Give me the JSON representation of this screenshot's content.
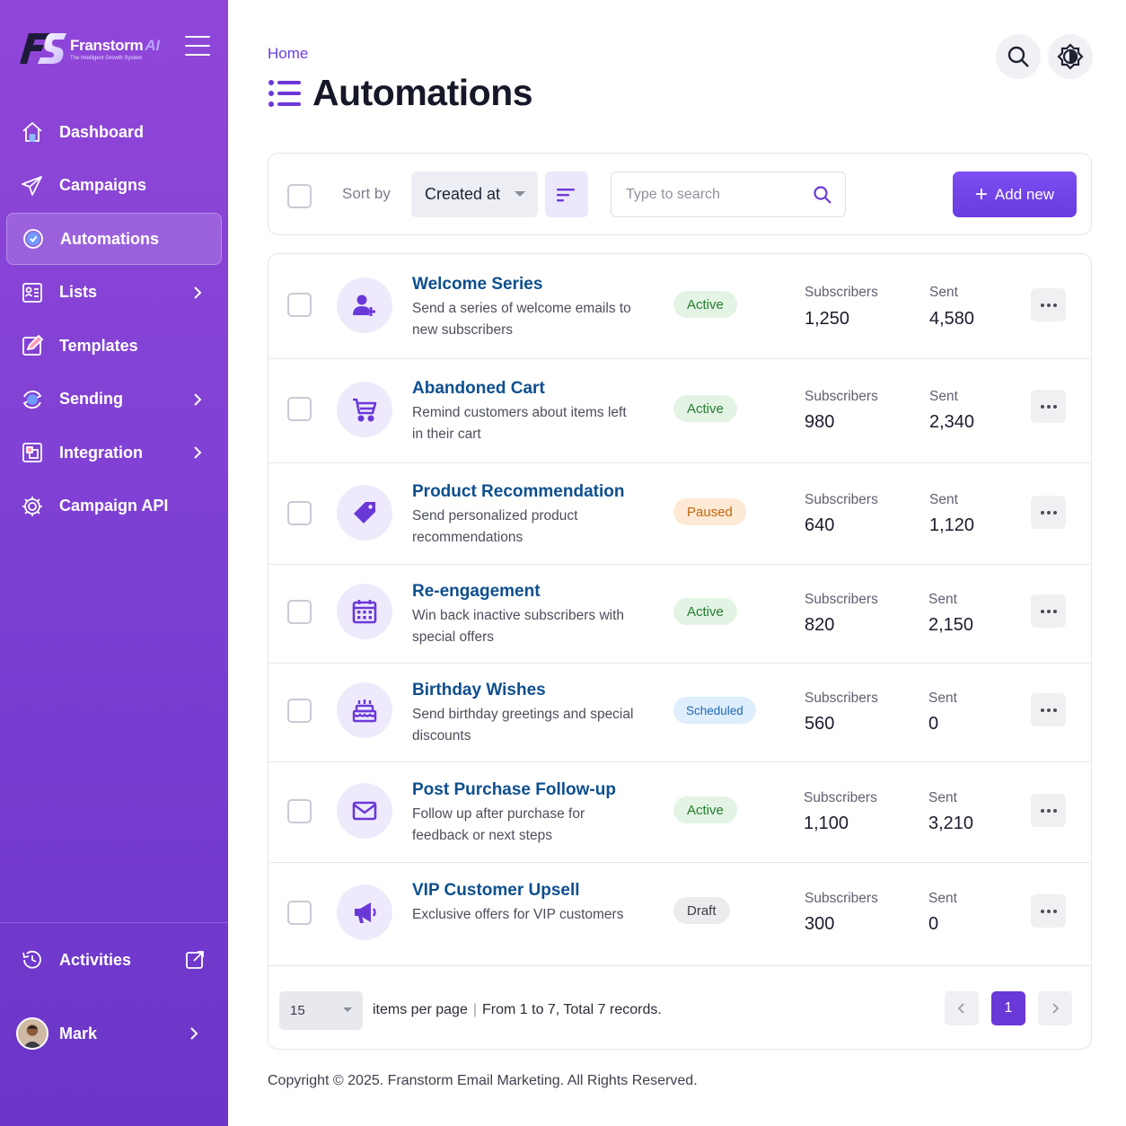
{
  "brand": {
    "name": "Franstorm",
    "suffix": "AI",
    "tagline": "The Intelligent Growth System"
  },
  "sidebar": {
    "items": [
      {
        "label": "Dashboard",
        "icon": "home-icon",
        "has_children": false
      },
      {
        "label": "Campaigns",
        "icon": "paper-plane-icon",
        "has_children": false
      },
      {
        "label": "Automations",
        "icon": "automation-cycle-icon",
        "has_children": false,
        "active": true
      },
      {
        "label": "Lists",
        "icon": "contact-list-icon",
        "has_children": true
      },
      {
        "label": "Templates",
        "icon": "template-edit-icon",
        "has_children": false
      },
      {
        "label": "Sending",
        "icon": "sending-cycle-icon",
        "has_children": true
      },
      {
        "label": "Integration",
        "icon": "integration-icon",
        "has_children": true
      },
      {
        "label": "Campaign API",
        "icon": "api-gear-icon",
        "has_children": false
      }
    ],
    "activities_label": "Activities",
    "user_name": "Mark"
  },
  "header": {
    "breadcrumb": "Home",
    "title": "Automations"
  },
  "toolbar": {
    "sort_label": "Sort by",
    "sort_value": "Created at",
    "search_placeholder": "Type to search",
    "add_label": "Add new"
  },
  "stat_labels": {
    "subscribers": "Subscribers",
    "sent": "Sent"
  },
  "automations": [
    {
      "title": "Welcome Series",
      "desc": "Send a series of welcome emails to new subscribers",
      "status": "Active",
      "status_kind": "active",
      "subscribers": "1,250",
      "sent": "4,580",
      "icon": "user-plus-icon"
    },
    {
      "title": "Abandoned Cart",
      "desc": "Remind customers about items left in their cart",
      "status": "Active",
      "status_kind": "active",
      "subscribers": "980",
      "sent": "2,340",
      "icon": "cart-icon"
    },
    {
      "title": "Product Recommendation",
      "desc": "Send personalized product recommendations",
      "status": "Paused",
      "status_kind": "paused",
      "subscribers": "640",
      "sent": "1,120",
      "icon": "tag-icon"
    },
    {
      "title": "Re-engagement",
      "desc": "Win back inactive subscribers with special offers",
      "status": "Active",
      "status_kind": "active",
      "subscribers": "820",
      "sent": "2,150",
      "icon": "calendar-icon"
    },
    {
      "title": "Birthday Wishes",
      "desc": "Send birthday greetings and special discounts",
      "status": "Scheduled",
      "status_kind": "scheduled",
      "subscribers": "560",
      "sent": "0",
      "icon": "cake-icon"
    },
    {
      "title": "Post Purchase Follow-up",
      "desc": "Follow up after purchase for feedback or next steps",
      "status": "Active",
      "status_kind": "active",
      "subscribers": "1,100",
      "sent": "3,210",
      "icon": "envelope-icon"
    },
    {
      "title": "VIP Customer Upsell",
      "desc": "Exclusive offers for VIP customers",
      "status": "Draft",
      "status_kind": "draft",
      "subscribers": "300",
      "sent": "0",
      "icon": "megaphone-icon"
    }
  ],
  "pagination": {
    "per_page": "15",
    "per_page_label": "items per page",
    "summary": "From 1 to 7, Total 7 records.",
    "current_page": "1"
  },
  "footer": {
    "copyright": "Copyright © 2025. Franstorm Email Marketing. All Rights Reserved."
  },
  "colors": {
    "accent": "#6b38d8",
    "sidebar": "#7b3fd2",
    "link": "#0e4f8f"
  }
}
